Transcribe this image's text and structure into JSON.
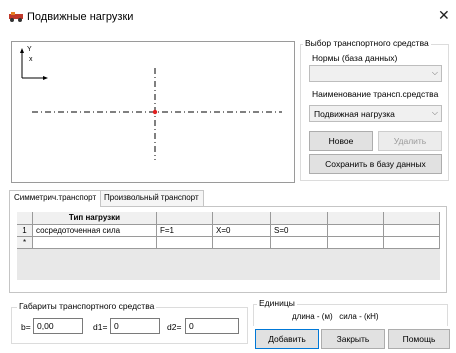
{
  "window": {
    "title": "Подвижные нагрузки"
  },
  "preview": {
    "axis_y": "Y",
    "axis_x": "X"
  },
  "vehicle": {
    "group_title": "Выбор транспортного средства",
    "norms_label": "Нормы (база данных)",
    "norms_value": "",
    "name_label": "Наименование трансп.средства",
    "name_value": "Подвижная нагрузка",
    "new_button": "Новое",
    "delete_button": "Удалить",
    "save_button": "Сохранить в базу данных"
  },
  "tabs": [
    {
      "label": "Симметрич.транспорт",
      "active": true
    },
    {
      "label": "Произвольный транспорт",
      "active": false
    }
  ],
  "grid": {
    "headers": [
      "Тип нагрузки",
      "",
      "",
      "",
      "",
      "",
      ""
    ],
    "rows": [
      {
        "row_header": "1",
        "cells": [
          "сосредоточенная сила",
          "F=1",
          "X=0",
          "S=0",
          "",
          "",
          ""
        ]
      },
      {
        "row_header": "*",
        "cells": [
          "",
          "",
          "",
          "",
          "",
          "",
          ""
        ]
      }
    ]
  },
  "dimensions": {
    "group_title": "Габариты транспортного средства",
    "b_label": "b=",
    "b_value": "0,00",
    "d1_label": "d1=",
    "d1_value": "0",
    "d2_label": "d2=",
    "d2_value": "0"
  },
  "units": {
    "group_title": "Единицы",
    "text": "длина - (м)   сила - (кН)"
  },
  "buttons": {
    "add": "Добавить",
    "close": "Закрыть",
    "help": "Помощь"
  }
}
